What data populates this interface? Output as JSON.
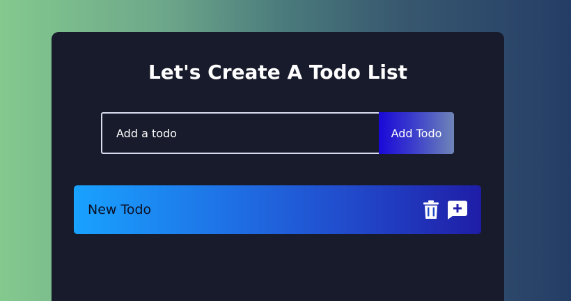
{
  "header": {
    "title": "Let's Create A Todo List"
  },
  "form": {
    "placeholder": "Add a todo",
    "value": "",
    "add_label": "Add Todo"
  },
  "todos": [
    {
      "text": "New Todo",
      "actions": [
        {
          "icon": "trash-icon"
        },
        {
          "icon": "comment-add-icon"
        }
      ]
    }
  ],
  "colors": {
    "card_background": "#181b2b",
    "title_text": "#ffffff",
    "input_border": "#d9dcef",
    "todo_gradient_start": "#19a2ff",
    "todo_gradient_end": "#1f1da7",
    "button_gradient_start": "#1a08d8",
    "button_gradient_end": "#6f85b8"
  }
}
